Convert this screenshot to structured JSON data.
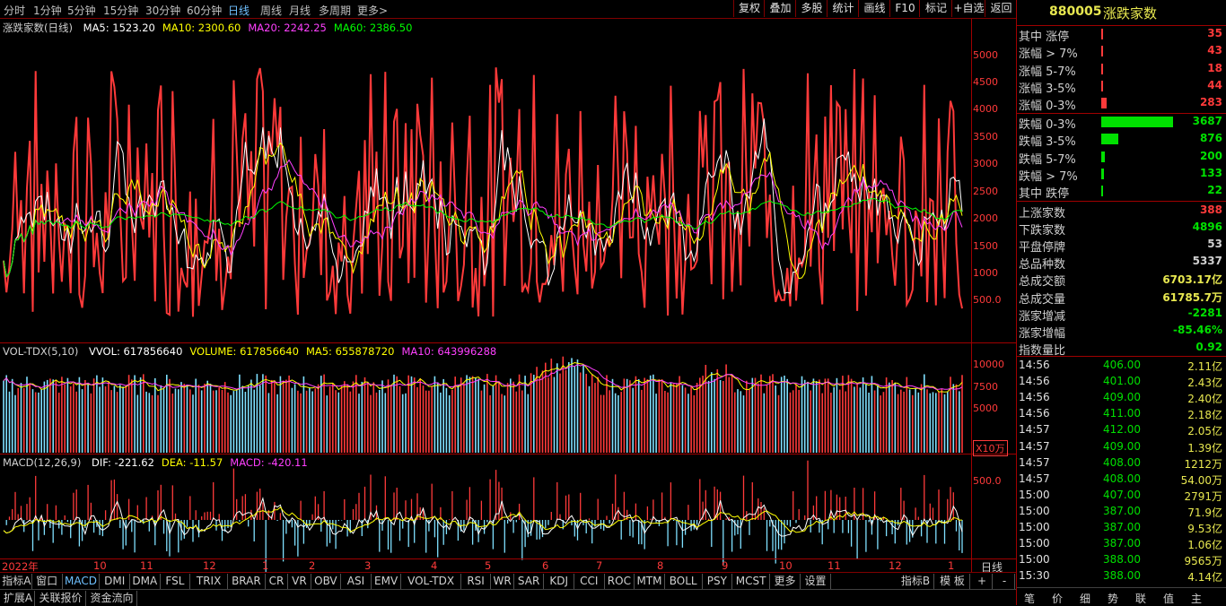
{
  "toolbar": {
    "periods": [
      "分时",
      "1分钟",
      "5分钟",
      "15分钟",
      "30分钟",
      "60分钟",
      "日线",
      "周线",
      "月线",
      "多周期",
      "更多>"
    ],
    "active_period": "日线",
    "buttons": [
      "复权",
      "叠加",
      "多股",
      "统计",
      "画线",
      "F10",
      "标记",
      "+自选",
      "返回"
    ]
  },
  "main_chart": {
    "title": "涨跌家数(日线)",
    "ma": [
      {
        "label": "MA5: 1523.20",
        "color": "#ffffff"
      },
      {
        "label": "MA10: 2300.60",
        "color": "#ffff00"
      },
      {
        "label": "MA20: 2242.25",
        "color": "#ff40ff"
      },
      {
        "label": "MA60: 2386.50",
        "color": "#00ff00"
      }
    ],
    "yaxis": [
      "5000",
      "4500",
      "4000",
      "3500",
      "3000",
      "2500",
      "2000",
      "1500",
      "1000",
      "500.0"
    ]
  },
  "volume_chart": {
    "title": "VOL-TDX(5,10)",
    "items": [
      {
        "label": "VVOL: 617856640",
        "color": "#ffffff"
      },
      {
        "label": "VOLUME: 617856640",
        "color": "#ffff00"
      },
      {
        "label": "MA5: 655878720",
        "color": "#ffff00"
      },
      {
        "label": "MA10: 643996288",
        "color": "#ff40ff"
      }
    ],
    "yaxis": [
      "10000",
      "7500",
      "5000"
    ],
    "unit": "X10万"
  },
  "macd_chart": {
    "title": "MACD(12,26,9)",
    "items": [
      {
        "label": "DIF: -221.62",
        "color": "#ffffff"
      },
      {
        "label": "DEA: -11.57",
        "color": "#ffff00"
      },
      {
        "label": "MACD: -420.11",
        "color": "#ff40ff"
      }
    ],
    "yaxis": [
      "500.0"
    ]
  },
  "xaxis": {
    "labels": [
      "2022年",
      "10",
      "11",
      "12",
      "1",
      "2",
      "3",
      "4",
      "5",
      "6",
      "7",
      "8",
      "9",
      "10",
      "11",
      "12",
      "1"
    ],
    "right_label": "日线"
  },
  "right_panel": {
    "code": "880005",
    "name": "涨跌家数",
    "up_rows": [
      {
        "label": "其中 涨停",
        "value": "35",
        "bar": 0.01
      },
      {
        "label": "涨幅 > 7%",
        "value": "43",
        "bar": 0.012
      },
      {
        "label": "涨幅 5-7%",
        "value": "18",
        "bar": 0.006
      },
      {
        "label": "涨幅 3-5%",
        "value": "44",
        "bar": 0.012
      },
      {
        "label": "涨幅 0-3%",
        "value": "283",
        "bar": 0.08
      }
    ],
    "down_rows": [
      {
        "label": "跌幅 0-3%",
        "value": "3687",
        "bar": 1.0
      },
      {
        "label": "跌幅 3-5%",
        "value": "876",
        "bar": 0.24
      },
      {
        "label": "跌幅 5-7%",
        "value": "200",
        "bar": 0.055
      },
      {
        "label": "跌幅 > 7%",
        "value": "133",
        "bar": 0.036
      },
      {
        "label": "其中 跌停",
        "value": "22",
        "bar": 0.006
      }
    ],
    "stats": [
      {
        "label": "上涨家数",
        "value": "388",
        "color": "#ff3a3a"
      },
      {
        "label": "下跌家数",
        "value": "4896",
        "color": "#00e000"
      },
      {
        "label": "平盘停牌",
        "value": "53",
        "color": "#d0d0d0"
      },
      {
        "label": "总品种数",
        "value": "5337",
        "color": "#d0d0d0"
      },
      {
        "label": "总成交额",
        "value": "6703.17亿",
        "color": "#e8e850"
      },
      {
        "label": "总成交量",
        "value": "61785.7万",
        "color": "#e8e850"
      },
      {
        "label": "涨家增减",
        "value": "-2281",
        "color": "#00e000"
      },
      {
        "label": "涨家增幅",
        "value": "-85.46%",
        "color": "#00e000"
      },
      {
        "label": "指数量比",
        "value": "0.92",
        "color": "#00e000"
      }
    ],
    "ticks": [
      {
        "time": "14:56",
        "price": "406.00",
        "vol": "2.11亿"
      },
      {
        "time": "14:56",
        "price": "401.00",
        "vol": "2.43亿"
      },
      {
        "time": "14:56",
        "price": "409.00",
        "vol": "2.40亿"
      },
      {
        "time": "14:56",
        "price": "411.00",
        "vol": "2.18亿"
      },
      {
        "time": "14:57",
        "price": "412.00",
        "vol": "2.05亿"
      },
      {
        "time": "14:57",
        "price": "409.00",
        "vol": "1.39亿"
      },
      {
        "time": "14:57",
        "price": "408.00",
        "vol": "1212万"
      },
      {
        "time": "14:57",
        "price": "408.00",
        "vol": "54.00万"
      },
      {
        "time": "15:00",
        "price": "407.00",
        "vol": "2791万"
      },
      {
        "time": "15:00",
        "price": "387.00",
        "vol": "71.9亿"
      },
      {
        "time": "15:00",
        "price": "387.00",
        "vol": "9.53亿"
      },
      {
        "time": "15:00",
        "price": "387.00",
        "vol": "1.06亿"
      },
      {
        "time": "15:00",
        "price": "388.00",
        "vol": "9565万"
      },
      {
        "time": "15:30",
        "price": "388.00",
        "vol": "4.14亿"
      }
    ],
    "bottom_tabs": [
      "笔",
      "价",
      "细",
      "势",
      "联",
      "值",
      "主"
    ]
  },
  "indicator_tabs": [
    "指标A",
    "窗口",
    "MACD",
    "DMI",
    "DMA",
    "FSL",
    "TRIX",
    "BRAR",
    "CR",
    "VR",
    "OBV",
    "ASI",
    "EMV",
    "VOL-TDX",
    "RSI",
    "WR",
    "SAR",
    "KDJ",
    "CCI",
    "ROC",
    "MTM",
    "BOLL",
    "PSY",
    "MCST",
    "更多",
    "设置"
  ],
  "active_indicator": "MACD",
  "indicator_right": [
    "指标B",
    "模 板",
    "+",
    "-"
  ],
  "bottom_tabs": [
    "扩展A",
    "关联报价",
    "资金流向"
  ]
}
